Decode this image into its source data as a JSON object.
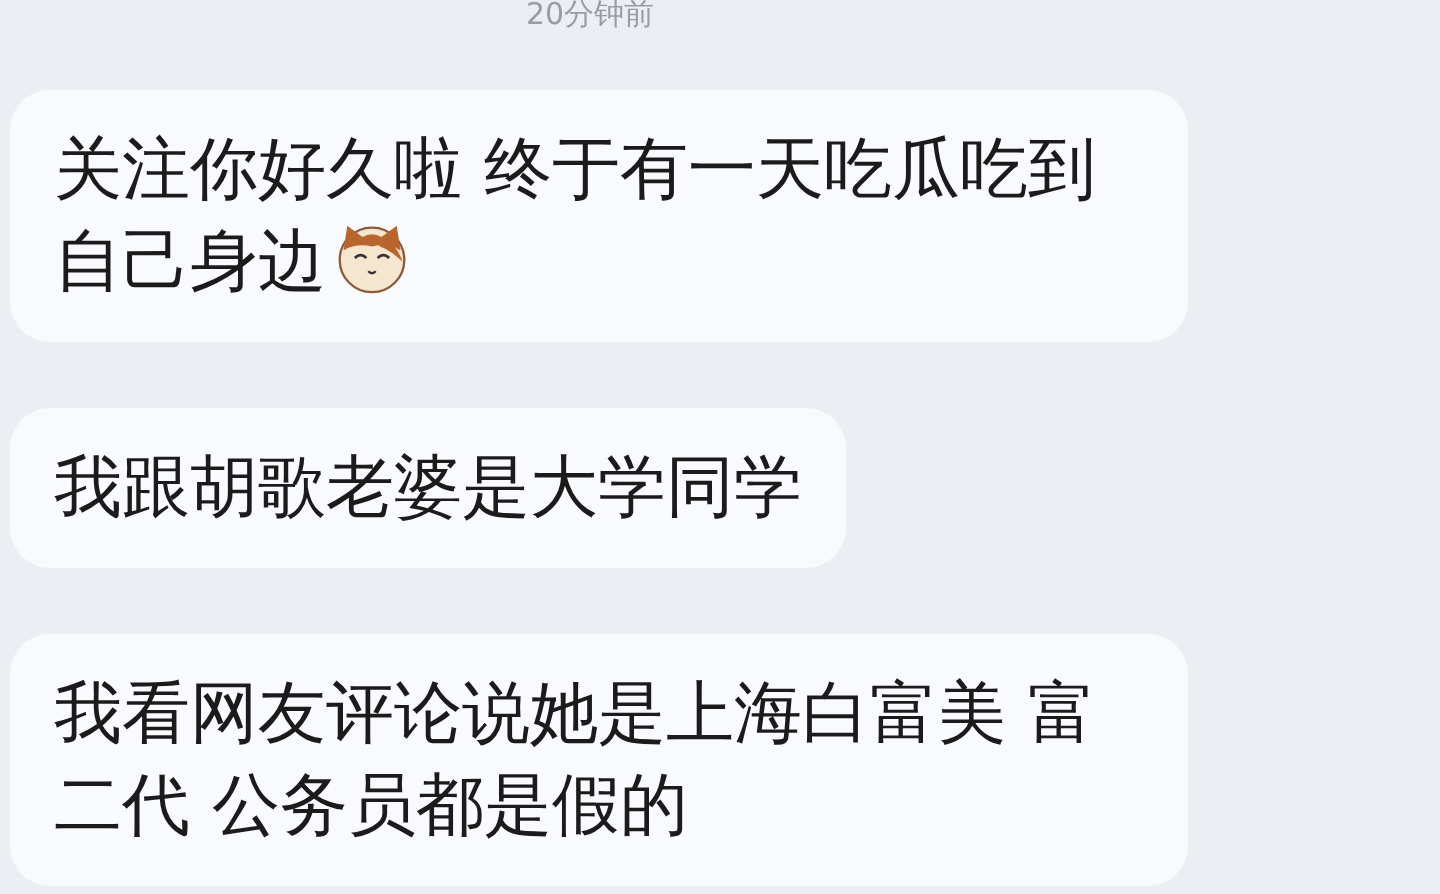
{
  "timestamp": "20分钟前",
  "messages": [
    {
      "text": "关注你好久啦 终于有一天吃瓜吃到自己身边",
      "sticker": true
    },
    {
      "text": "我跟胡歌老婆是大学同学",
      "sticker": false
    },
    {
      "text": "我看网友评论说她是上海白富美 富二代 公务员都是假的",
      "sticker": false
    }
  ]
}
